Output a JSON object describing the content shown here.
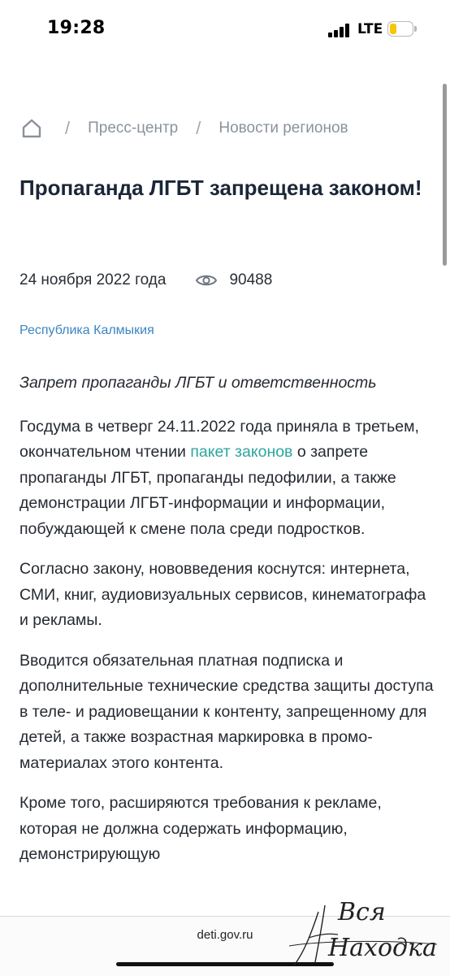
{
  "status_bar": {
    "time": "19:28",
    "network": "LTE",
    "battery_level": 0.3,
    "battery_color": "#f6c60b"
  },
  "breadcrumb": {
    "home_icon": "home-icon",
    "separator": "/",
    "items": [
      "Пресс-центр",
      "Новости регионов"
    ]
  },
  "article": {
    "title": "Пропаганда ЛГБТ запрещена законом!",
    "date": "24 ноября 2022 года",
    "views_icon": "eye-icon",
    "views": "90488",
    "region": "Республика Калмыкия",
    "lead": "Запрет пропаганды ЛГБТ и ответственность",
    "p1_before": "Госдума в четверг 24.11.2022 года приняла в третьем, окончательном чтении ",
    "p1_link": "пакет законов",
    "p1_after": " о запрете пропаганды ЛГБТ, пропаганды педофилии, а также демонстрации ЛГБТ-информации и информации, побуждающей к смене пола среди подростков.",
    "p2": "Согласно закону, нововведения коснутся: интернета, СМИ, книг, аудиовизуальных сервисов, кинематографа и рекламы.",
    "p3": "Вводится обязательная платная подписка и дополнительные технические средства защиты доступа в теле- и радиовещании к контенту, запрещенному для детей, а также возрастная маркировка в промо-материалах этого контента.",
    "p4": "Кроме того, расширяются требования к рекламе, которая не должна содержать информацию, демонстрирующую"
  },
  "colors": {
    "link": "#2ea59e",
    "region_link": "#3a85c4",
    "title": "#1b2638"
  },
  "browser": {
    "url": "deti.gov.ru"
  },
  "watermark": {
    "text_line1": "Вся",
    "text_line2": "Находка"
  }
}
